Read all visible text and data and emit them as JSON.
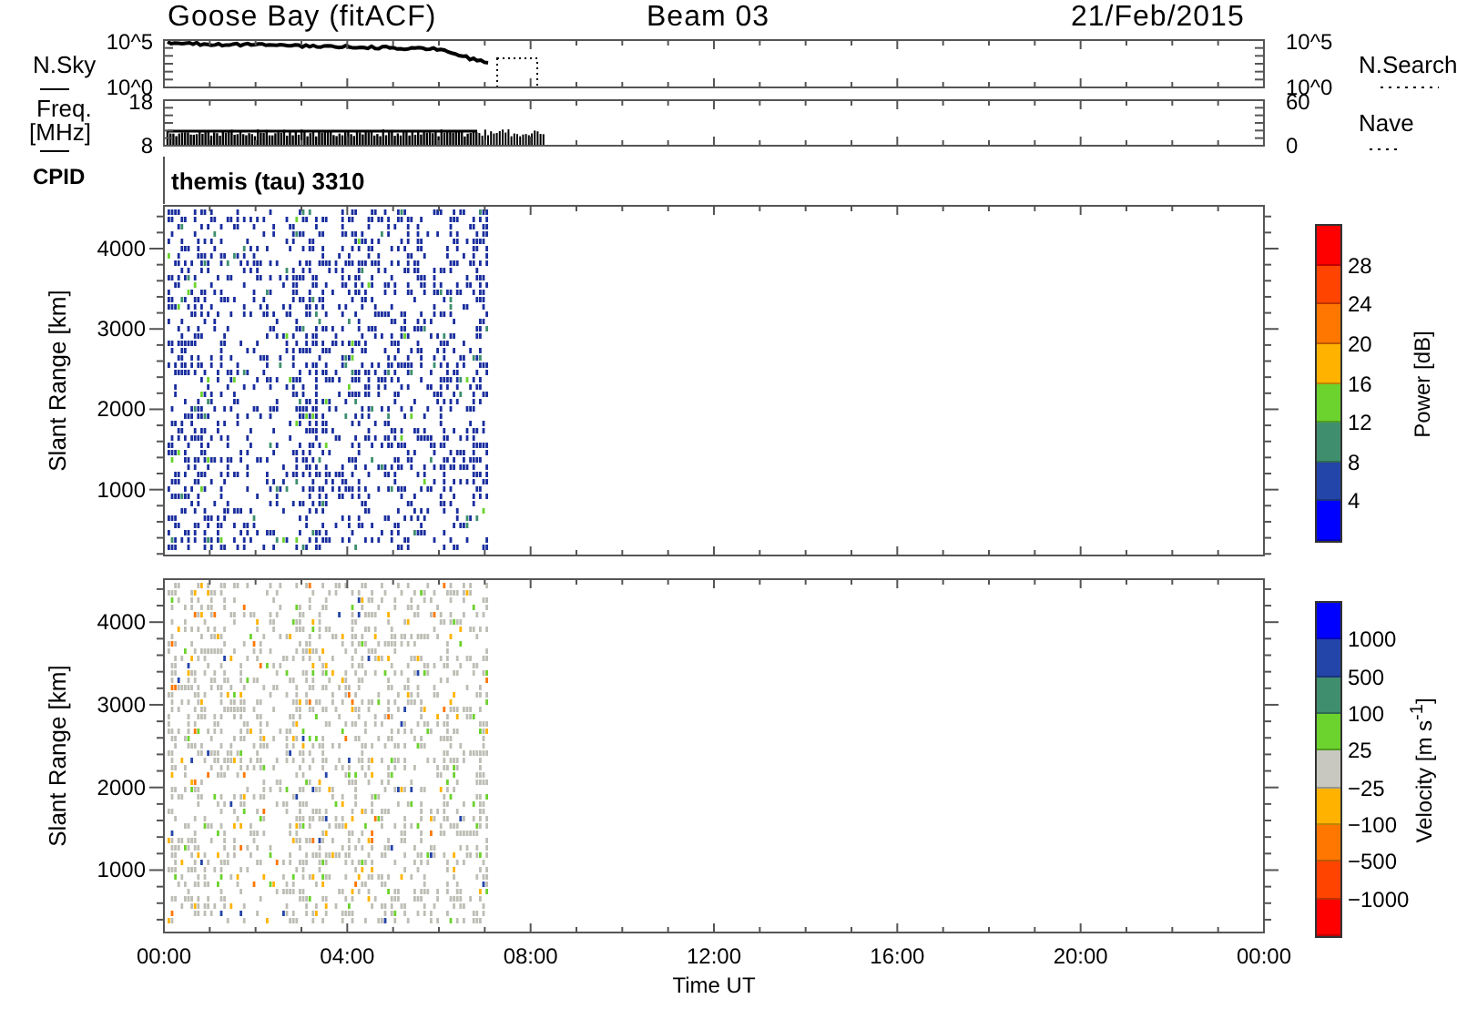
{
  "header": {
    "station": "Goose Bay (fitACF)",
    "beam": "Beam 03",
    "date": "21/Feb/2015"
  },
  "nsky_panel": {
    "label": "N.Sky",
    "left_ticks": [
      "10^5",
      "10^0"
    ],
    "right_ticks": [
      "10^5",
      "10^0"
    ],
    "right_label": "N.Search"
  },
  "freq_panel": {
    "label": "Freq.",
    "unit": "[MHz]",
    "left_ticks": [
      "18",
      "8"
    ],
    "right_ticks": [
      "60",
      "0"
    ],
    "right_label": "Nave"
  },
  "cpid_row": {
    "label": "CPID",
    "text": "themis (tau) 3310"
  },
  "power_panel": {
    "ylabel": "Slant Range [km]",
    "yticks": [
      "4000",
      "3000",
      "2000",
      "1000"
    ],
    "colorbar": {
      "title": "Power [dB]",
      "labels": [
        "28",
        "24",
        "20",
        "16",
        "12",
        "8",
        "4"
      ],
      "bands": [
        {
          "color": "#ff0000"
        },
        {
          "color": "#ff4400"
        },
        {
          "color": "#ff7700"
        },
        {
          "color": "#ffb300"
        },
        {
          "color": "#6cd22e"
        },
        {
          "color": "#3f8f6e"
        },
        {
          "color": "#2344a8"
        },
        {
          "color": "#0000ff"
        }
      ]
    }
  },
  "velocity_panel": {
    "ylabel": "Slant Range [km]",
    "yticks": [
      "4000",
      "3000",
      "2000",
      "1000"
    ],
    "colorbar": {
      "title": "Velocity [m s$^{-1}$]",
      "labels": [
        "1000",
        "500",
        "100",
        "25",
        "−25",
        "−100",
        "−500",
        "−1000"
      ],
      "bands": [
        {
          "color": "#0000ff"
        },
        {
          "color": "#2344a8"
        },
        {
          "color": "#3f8f6e"
        },
        {
          "color": "#6cd22e"
        },
        {
          "color": "#c8c8c0"
        },
        {
          "color": "#ffb300"
        },
        {
          "color": "#ff7700"
        },
        {
          "color": "#ff4400"
        },
        {
          "color": "#ff0000"
        }
      ]
    }
  },
  "x_axis": {
    "ticks": [
      "00:00",
      "04:00",
      "08:00",
      "12:00",
      "16:00",
      "20:00",
      "00:00"
    ],
    "title": "Time UT"
  }
}
